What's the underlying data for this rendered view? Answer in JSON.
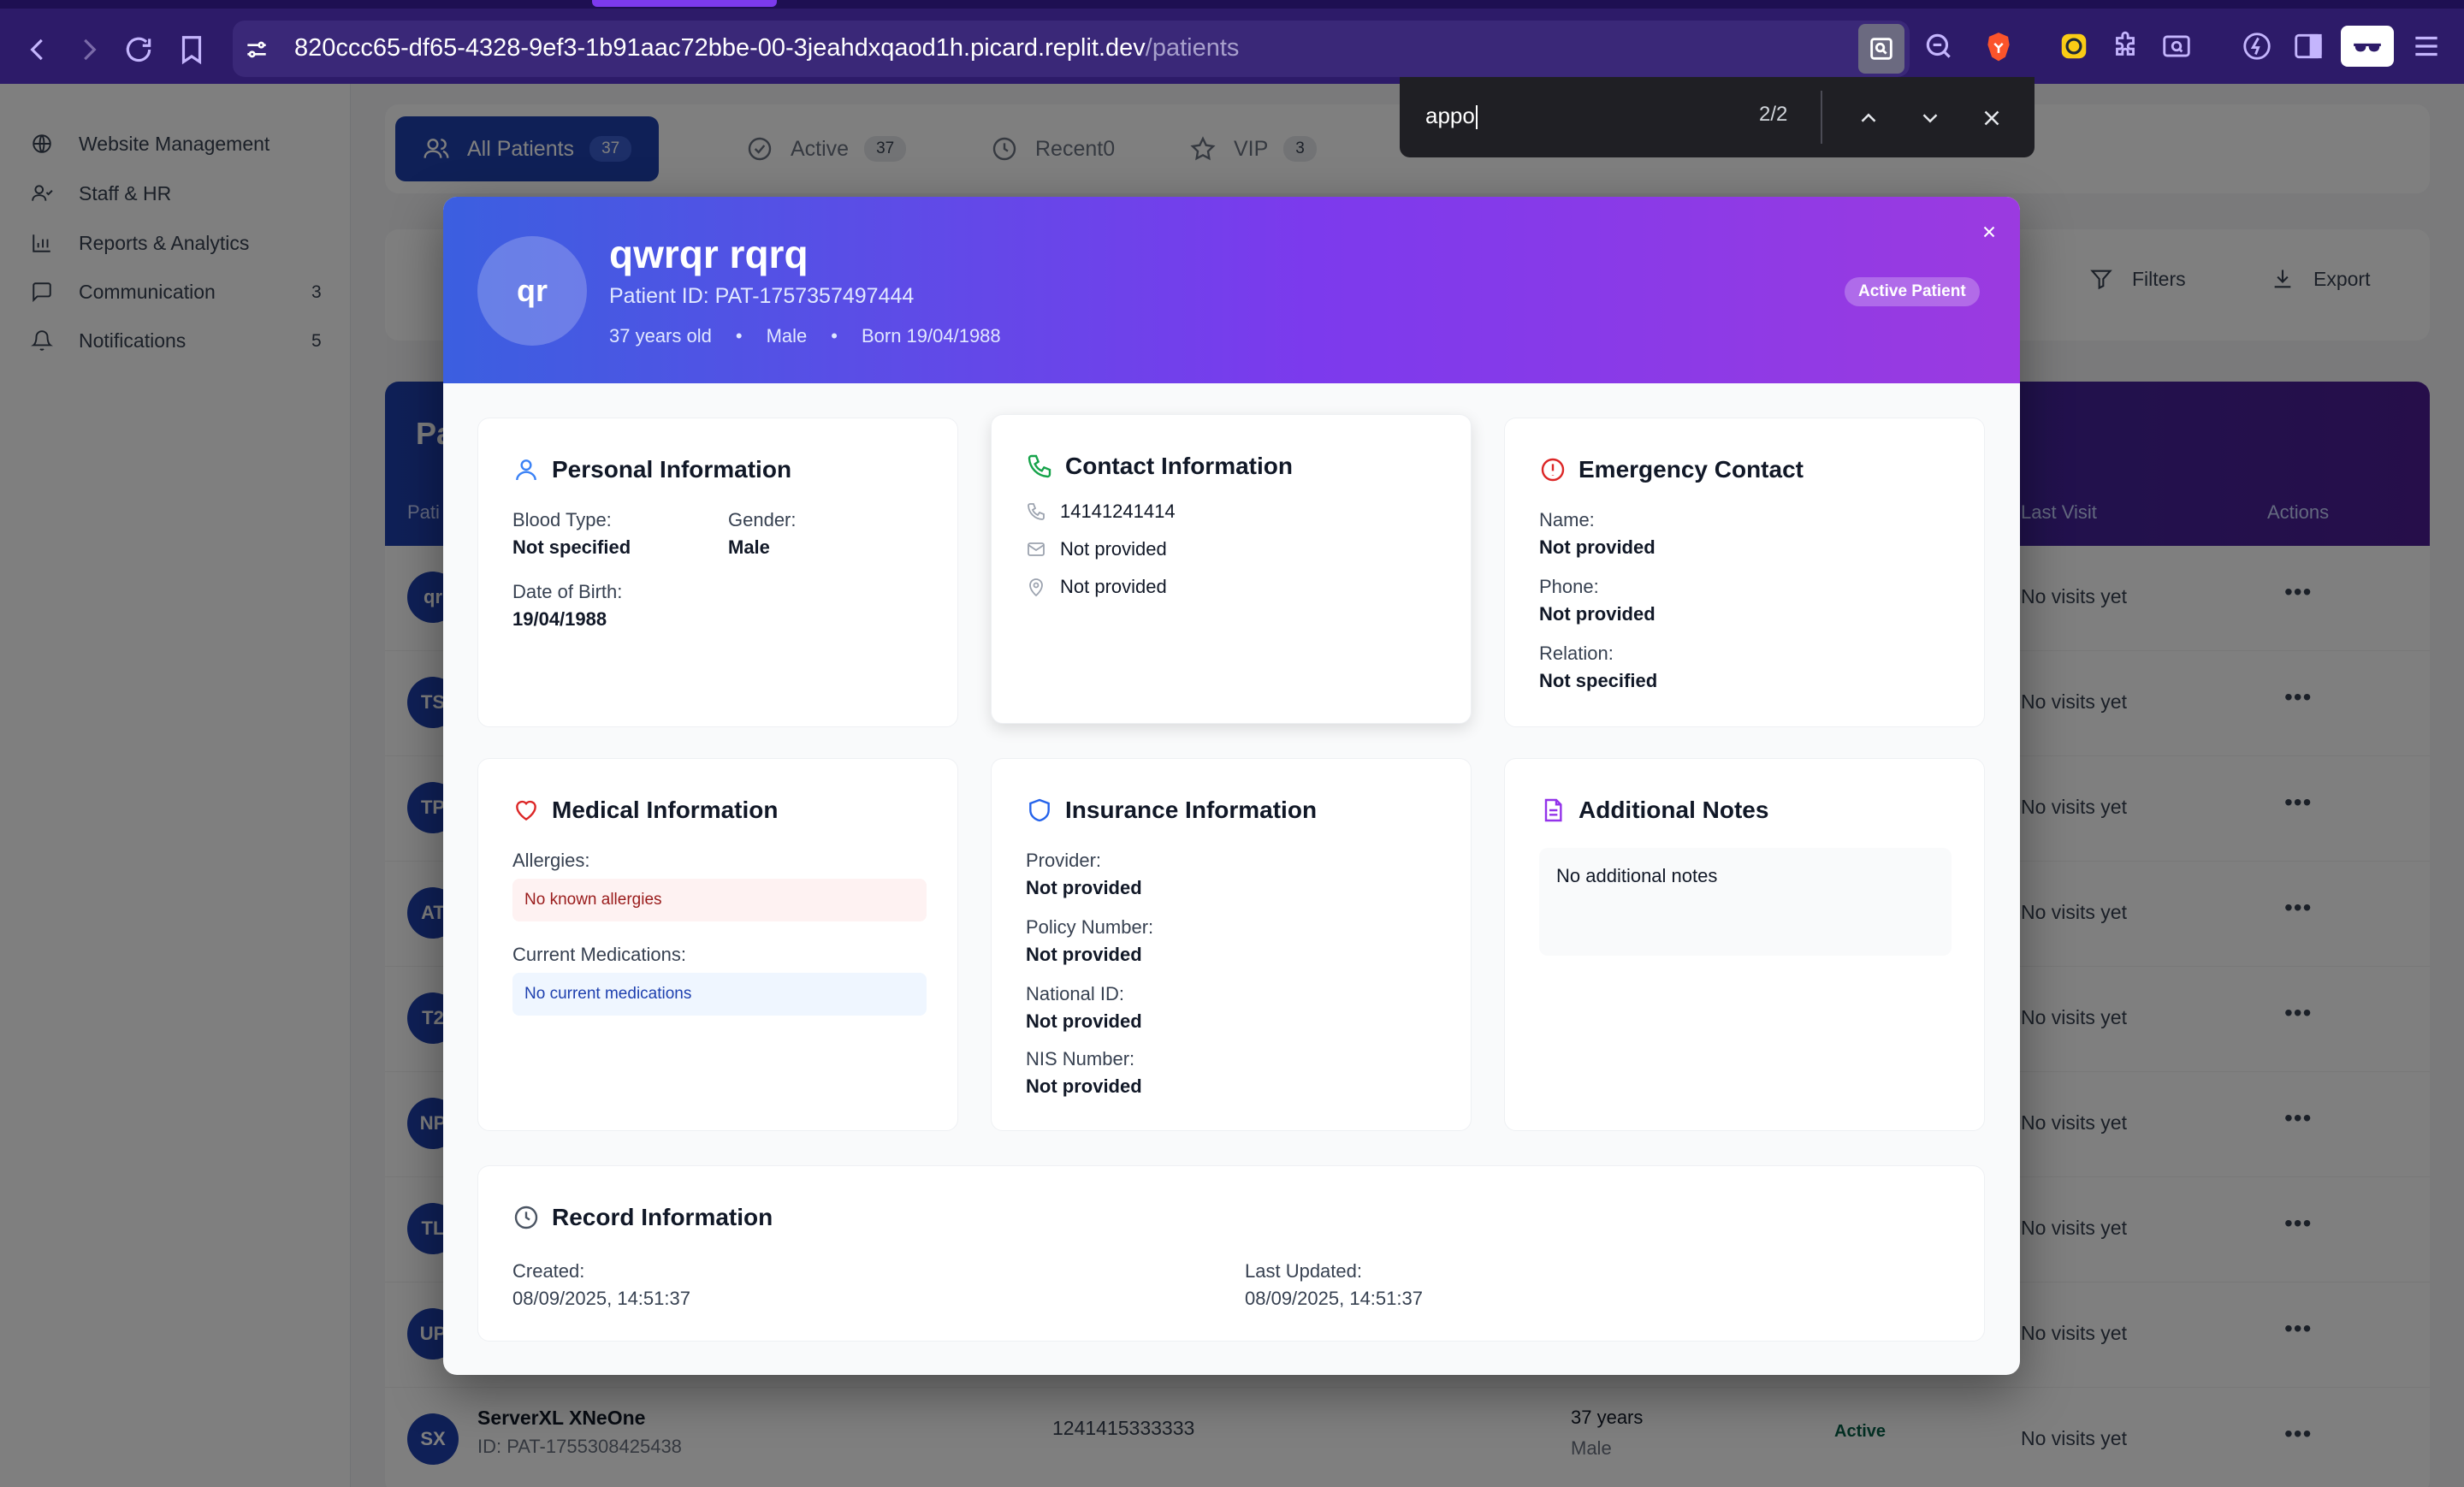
{
  "browser": {
    "url_host": "820ccc65-df65-4328-9ef3-1b91aac72bbe-00-3jeahdxqaod1h.picard.replit.dev",
    "url_path": "/patients"
  },
  "find_bar": {
    "query": "appo",
    "match_count": "2/2"
  },
  "sidebar": {
    "items": [
      {
        "label": "Website Management",
        "icon": "globe-icon"
      },
      {
        "label": "Staff & HR",
        "icon": "users-icon"
      },
      {
        "label": "Reports & Analytics",
        "icon": "bar-chart-icon"
      },
      {
        "label": "Communication",
        "icon": "message-icon",
        "count": "3"
      },
      {
        "label": "Notifications",
        "icon": "bell-icon",
        "count": "5"
      }
    ]
  },
  "patient_tabs": [
    {
      "label": "All Patients",
      "count": "37"
    },
    {
      "label": "Active",
      "count": "37"
    },
    {
      "label": "Recent0"
    },
    {
      "label": "VIP",
      "count": "3"
    }
  ],
  "toolbar": {
    "filters_label": "Filters",
    "export_label": "Export"
  },
  "table": {
    "title_fragment": "Pa",
    "headers": {
      "patient": "Pati",
      "last_visit": "Last Visit",
      "actions": "Actions"
    },
    "rows": [
      {
        "initials": "qr",
        "last_visit": "No visits yet"
      },
      {
        "initials": "TS",
        "last_visit": "No visits yet"
      },
      {
        "initials": "TP",
        "last_visit": "No visits yet"
      },
      {
        "initials": "AT",
        "last_visit": "No visits yet"
      },
      {
        "initials": "T2",
        "last_visit": "No visits yet"
      },
      {
        "initials": "NP",
        "last_visit": "No visits yet"
      },
      {
        "initials": "TL",
        "last_visit": "No visits yet"
      },
      {
        "initials": "UP",
        "last_visit": "No visits yet"
      },
      {
        "initials": "SX",
        "name": "ServerXL XNeOne",
        "id": "ID: PAT-1755308425438",
        "phone": "1241415333333",
        "age": "37 years",
        "gender": "Male",
        "status": "Active",
        "last_visit": "No visits yet"
      }
    ]
  },
  "modal": {
    "avatar_initials": "qr",
    "name": "qwrqr rqrq",
    "patient_id": "Patient ID: PAT-1757357497444",
    "age": "37 years old",
    "gender": "Male",
    "born": "Born 19/04/1988",
    "status_badge": "Active Patient",
    "personal": {
      "title": "Personal Information",
      "blood_type_label": "Blood Type:",
      "blood_type": "Not specified",
      "gender_label": "Gender:",
      "gender": "Male",
      "dob_label": "Date of Birth:",
      "dob": "19/04/1988"
    },
    "contact": {
      "title": "Contact Information",
      "phone": "14141241414",
      "email": "Not provided",
      "address": "Not provided"
    },
    "emergency": {
      "title": "Emergency Contact",
      "name_label": "Name:",
      "name": "Not provided",
      "phone_label": "Phone:",
      "phone": "Not provided",
      "relation_label": "Relation:",
      "relation": "Not specified"
    },
    "medical": {
      "title": "Medical Information",
      "allergies_label": "Allergies:",
      "allergies": "No known allergies",
      "medications_label": "Current Medications:",
      "medications": "No current medications"
    },
    "insurance": {
      "title": "Insurance Information",
      "provider_label": "Provider:",
      "provider": "Not provided",
      "policy_label": "Policy Number:",
      "policy": "Not provided",
      "national_id_label": "National ID:",
      "national_id": "Not provided",
      "nis_label": "NIS Number:",
      "nis": "Not provided"
    },
    "notes": {
      "title": "Additional Notes",
      "text": "No additional notes"
    },
    "record": {
      "title": "Record Information",
      "created_label": "Created:",
      "created": "08/09/2025, 14:51:37",
      "updated_label": "Last Updated:",
      "updated": "08/09/2025, 14:51:37"
    }
  },
  "colors": {
    "header_gradient_start": "#3b5fe0",
    "header_gradient_end": "#9b3ae0",
    "browser_bar": "#2d1b69",
    "allergy_bg": "#fef2f2",
    "medication_bg": "#eff6ff"
  }
}
